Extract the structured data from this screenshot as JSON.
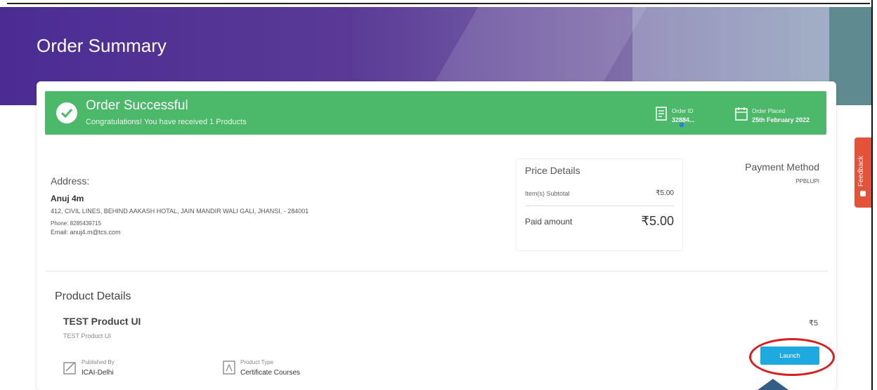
{
  "header": {
    "title": "Order Summary"
  },
  "success_banner": {
    "title": "Order Successful",
    "subtitle": "Congratulations! You have received 1 Products",
    "order_id_label": "Order ID",
    "order_id_value": "32884...",
    "order_placed_label": "Order Placed",
    "order_placed_value": "25th February 2022"
  },
  "address": {
    "label": "Address:",
    "name": "Anuj 4m",
    "line": "412, CIVIL LINES, BEHIND AAKASH HOTAL, JAIN MANDIR WALI GALI, JHANSI, - 284001",
    "phone": "Phone: 8285439715",
    "email": "Email: anuj4.m@tcs.com"
  },
  "price_details": {
    "title": "Price Details",
    "subtotal_label": "Item(s) Subtotal",
    "subtotal_value": "₹5.00",
    "paid_label": "Paid amount",
    "paid_value": "₹5.00"
  },
  "payment": {
    "title": "Payment Method",
    "value": "PPBLUPI"
  },
  "product": {
    "heading": "Product Details",
    "name": "TEST Product UI",
    "subtitle": "TEST Product UI",
    "price": "₹5",
    "published_by_label": "Published By",
    "published_by_value": "ICAI-Delhi",
    "product_type_label": "Product Type",
    "product_type_value": "Certificate Courses",
    "launch_label": "Launch"
  },
  "feedback": {
    "label": "Feedback"
  },
  "colors": {
    "success": "#4cb86a",
    "launch": "#1fa9e1",
    "highlight": "#d81e1e",
    "feedback": "#e2533a"
  }
}
